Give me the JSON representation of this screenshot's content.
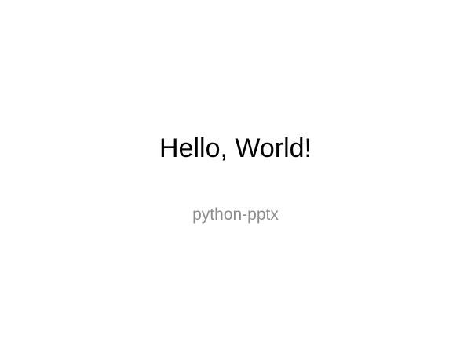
{
  "slide": {
    "title": "Hello, World!",
    "subtitle": "python-pptx"
  },
  "colors": {
    "background": "#ffffff",
    "title": "#000000",
    "subtitle": "#8c8c8c"
  }
}
